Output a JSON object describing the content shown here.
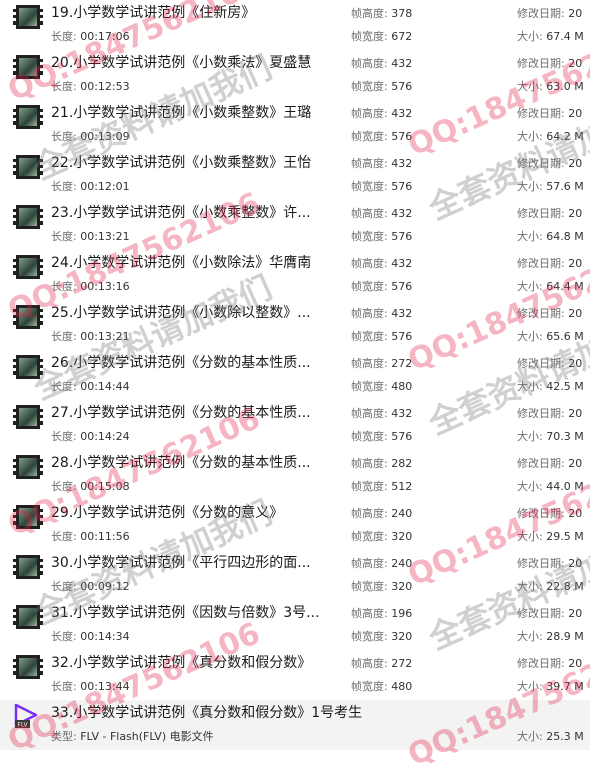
{
  "labels": {
    "duration": "长度:",
    "frame_height": "帧高度:",
    "frame_width": "帧宽度:",
    "modified": "修改日期:",
    "size": "大小:"
  },
  "colors": {
    "selected_row": "#f3f3f3",
    "watermark_red": "#e11e46",
    "flv_icon": "#7b2ff7"
  },
  "watermark": {
    "qq": "QQ:1847562106",
    "slogan": "全套资料请加我们"
  },
  "items": [
    {
      "title": "19.小学数学试讲范例《住新房》",
      "duration": "00:17:06",
      "height": "378",
      "width": "672",
      "modified": "20",
      "size": "67.4 M"
    },
    {
      "title": "20.小学数学试讲范例《小数乘法》夏盛慧",
      "duration": "00:12:53",
      "height": "432",
      "width": "576",
      "modified": "20",
      "size": "63.0 M"
    },
    {
      "title": "21.小学数学试讲范例《小数乘整数》王璐",
      "duration": "00:13:09",
      "height": "432",
      "width": "576",
      "modified": "20",
      "size": "64.2 M"
    },
    {
      "title": "22.小学数学试讲范例《小数乘整数》王怡",
      "duration": "00:12:01",
      "height": "432",
      "width": "576",
      "modified": "20",
      "size": "57.6 M"
    },
    {
      "title": "23.小学数学试讲范例《小数乘整数》许...",
      "duration": "00:13:21",
      "height": "432",
      "width": "576",
      "modified": "20",
      "size": "64.8 M"
    },
    {
      "title": "24.小学数学试讲范例《小数除法》华膺南",
      "duration": "00:13:16",
      "height": "432",
      "width": "576",
      "modified": "20",
      "size": "64.4 M"
    },
    {
      "title": "25.小学数学试讲范例《小数除以整数》...",
      "duration": "00:13:21",
      "height": "432",
      "width": "576",
      "modified": "20",
      "size": "65.6 M"
    },
    {
      "title": "26.小学数学试讲范例《分数的基本性质...",
      "duration": "00:14:44",
      "height": "272",
      "width": "480",
      "modified": "20",
      "size": "42.5 M"
    },
    {
      "title": "27.小学数学试讲范例《分数的基本性质...",
      "duration": "00:14:24",
      "height": "432",
      "width": "576",
      "modified": "20",
      "size": "70.3 M"
    },
    {
      "title": "28.小学数学试讲范例《分数的基本性质...",
      "duration": "00:15:08",
      "height": "282",
      "width": "512",
      "modified": "20",
      "size": "44.0 M"
    },
    {
      "title": "29.小学数学试讲范例《分数的意义》",
      "duration": "00:11:56",
      "height": "240",
      "width": "320",
      "modified": "20",
      "size": "29.5 M"
    },
    {
      "title": "30.小学数学试讲范例《平行四边形的面...",
      "duration": "00:09:12",
      "height": "240",
      "width": "320",
      "modified": "20",
      "size": "22.8 M"
    },
    {
      "title": "31.小学数学试讲范例《因数与倍数》3号...",
      "duration": "00:14:34",
      "height": "196",
      "width": "320",
      "modified": "20",
      "size": "28.9 M"
    },
    {
      "title": "32.小学数学试讲范例《真分数和假分数》",
      "duration": "00:13:44",
      "height": "272",
      "width": "480",
      "modified": "20",
      "size": "39.7 M"
    }
  ],
  "last_item": {
    "title": "33.小学数学试讲范例《真分数和假分数》1号考生",
    "type_label": "类型:",
    "type_value": "FLV - Flash(FLV) 电影文件",
    "size": "25.3 M",
    "icon_text": "FLV"
  }
}
